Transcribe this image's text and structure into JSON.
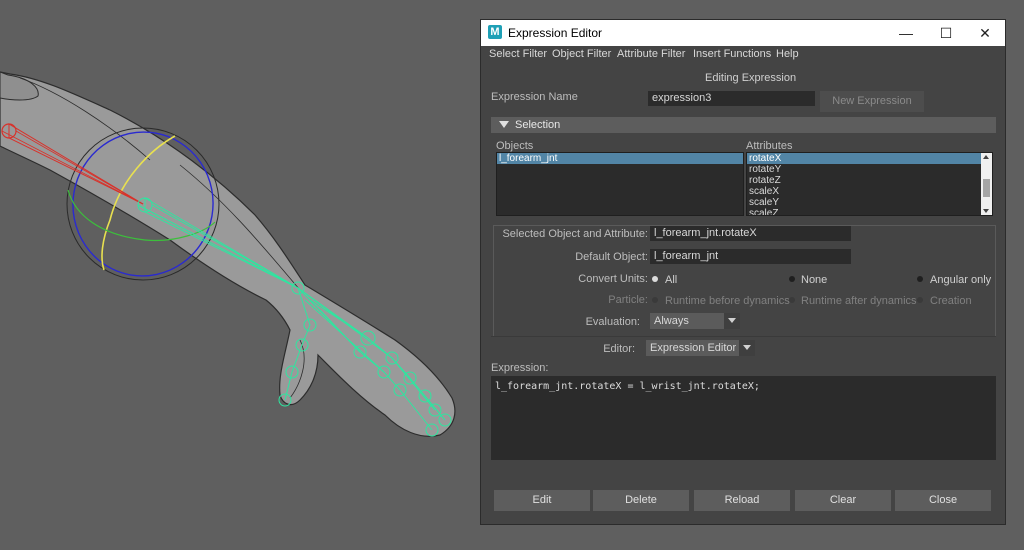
{
  "window": {
    "title": "Expression Editor",
    "app_icon_letter": "M",
    "controls": {
      "minimize": "—",
      "maximize": "☐",
      "close": "✕"
    }
  },
  "menu": [
    "Select Filter",
    "Object Filter",
    "Attribute Filter",
    "Insert Functions",
    "Help"
  ],
  "header": {
    "mode": "Editing Expression"
  },
  "expression_name": {
    "label": "Expression Name",
    "value": "expression3",
    "new_button": "New Expression"
  },
  "selection": {
    "title": "Selection",
    "objects_label": "Objects",
    "attributes_label": "Attributes",
    "objects": [
      "l_forearm_jnt"
    ],
    "selected_object": "l_forearm_jnt",
    "attributes": [
      "rotateX",
      "rotateY",
      "rotateZ",
      "scaleX",
      "scaleY",
      "scaleZ"
    ],
    "selected_attribute": "rotateX"
  },
  "details": {
    "selected_label": "Selected Object and Attribute:",
    "selected_value": "l_forearm_jnt.rotateX",
    "default_label": "Default Object:",
    "default_value": "l_forearm_jnt",
    "convert_units_label": "Convert Units:",
    "convert_units_options": [
      "All",
      "None",
      "Angular only"
    ],
    "convert_units_selected": "All",
    "particle_label": "Particle:",
    "particle_options": [
      "Runtime before dynamics",
      "Runtime after dynamics",
      "Creation"
    ],
    "evaluation_label": "Evaluation:",
    "evaluation_value": "Always",
    "editor_label": "Editor:",
    "editor_value": "Expression Editor"
  },
  "expression": {
    "label": "Expression:",
    "code": "l_forearm_jnt.rotateX = l_wrist_jnt.rotateX;"
  },
  "buttons": {
    "edit": "Edit",
    "delete": "Delete",
    "reload": "Reload",
    "clear": "Clear",
    "close": "Close"
  },
  "colors": {
    "viewport_bg": "#5f5f5f",
    "panel_bg": "#444444",
    "field_bg": "#2b2b2b",
    "selection_highlight": "#5285a6",
    "joint_green": "#2ee6a0",
    "rotate_x_red": "#d8312a",
    "manipulator_blue": "#2a2ad0",
    "manipulator_yellow": "#e8e050"
  }
}
